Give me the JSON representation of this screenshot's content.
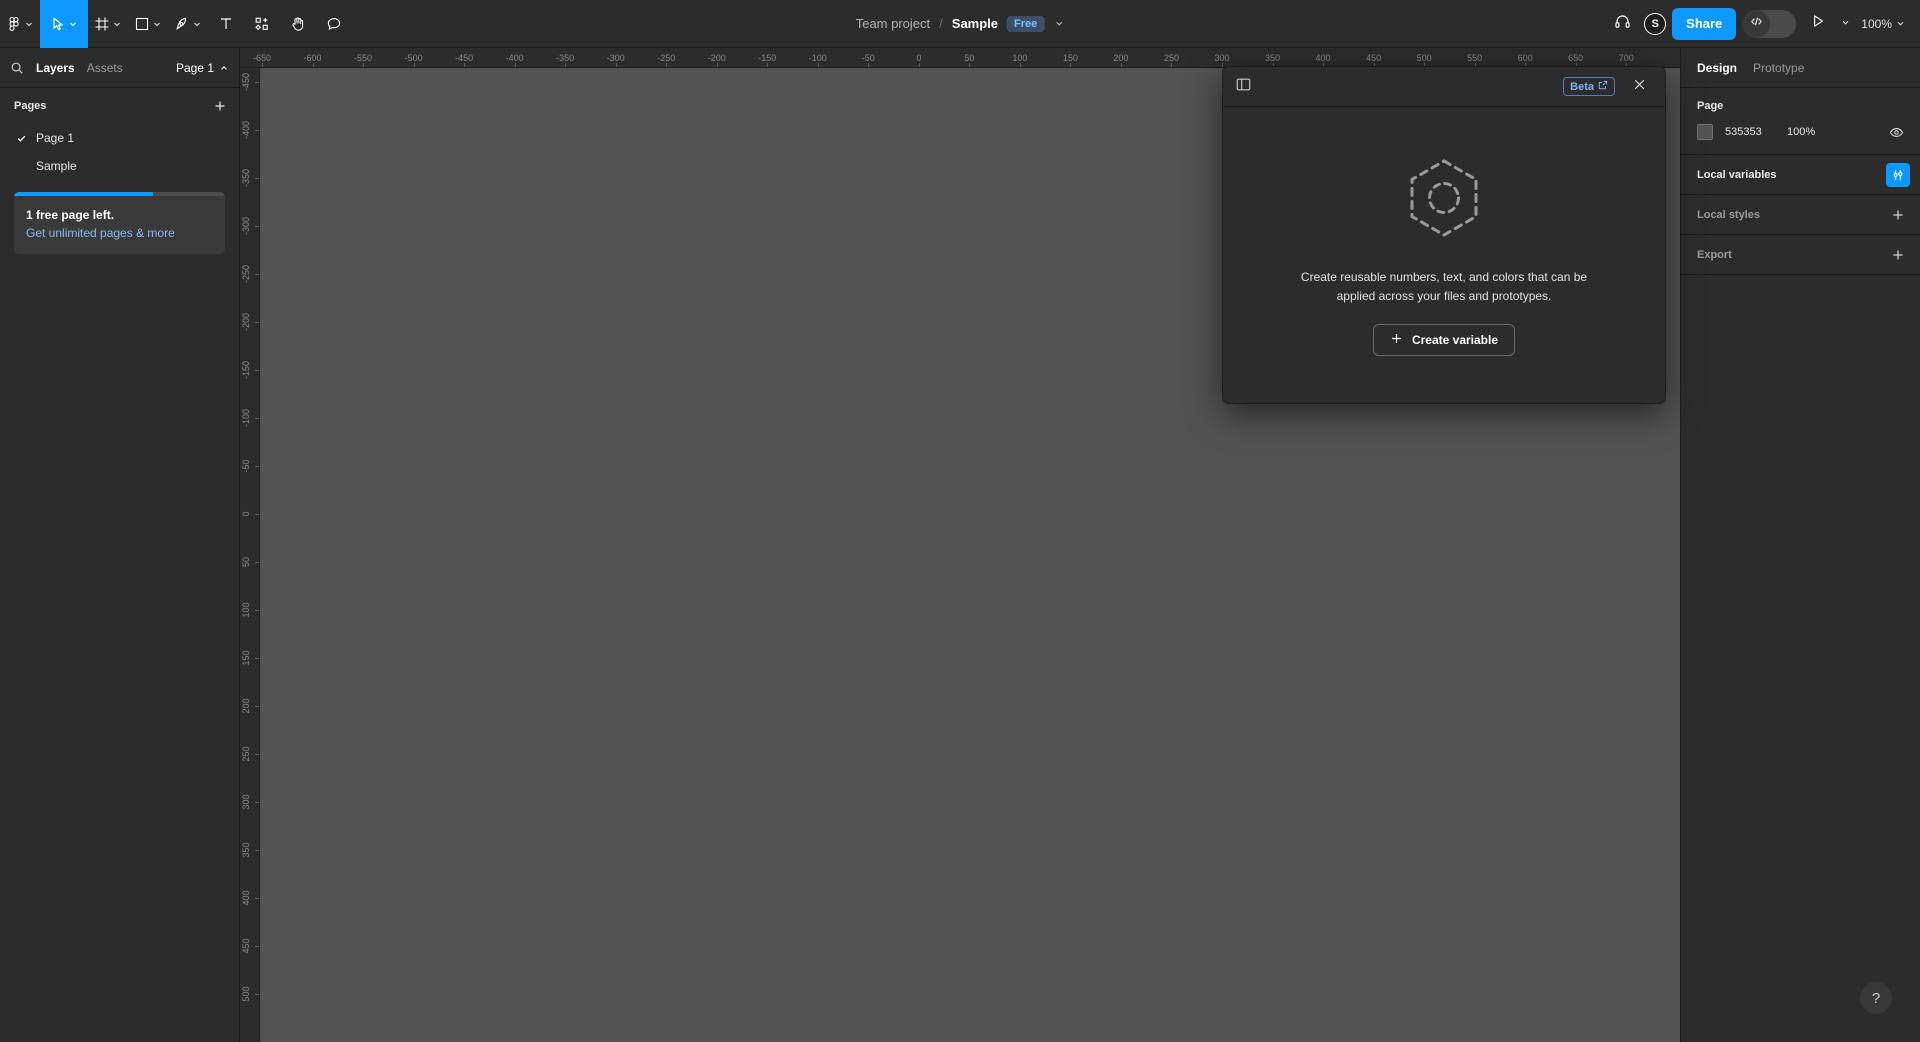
{
  "toolbar": {
    "tools": [
      {
        "name": "figma-logo",
        "icon": "figma-logo-icon",
        "has_chevron": true,
        "active": false
      },
      {
        "name": "move-tool",
        "icon": "cursor-arrow-icon",
        "has_chevron": true,
        "active": true
      },
      {
        "name": "frame-tool",
        "icon": "frame-icon",
        "has_chevron": true,
        "active": false
      },
      {
        "name": "shape-tool",
        "icon": "square-icon",
        "has_chevron": true,
        "active": false
      },
      {
        "name": "pen-tool",
        "icon": "pen-icon",
        "has_chevron": true,
        "active": false
      },
      {
        "name": "text-tool",
        "icon": "text-t-icon",
        "has_chevron": false,
        "active": false
      },
      {
        "name": "resources-tool",
        "icon": "resources-plugin-icon",
        "has_chevron": false,
        "active": false
      },
      {
        "name": "hand-tool",
        "icon": "hand-icon",
        "has_chevron": false,
        "active": false
      },
      {
        "name": "comment-tool",
        "icon": "comment-bubble-icon",
        "has_chevron": false,
        "active": false
      }
    ],
    "breadcrumb": {
      "project": "Team project",
      "separator": "/",
      "file": "Sample",
      "plan_badge": "Free"
    },
    "right": {
      "headphones_icon": "headphones-icon",
      "avatar_initial": "S",
      "share_label": "Share",
      "dev_mode_icon": "code-brackets-icon",
      "present_icon": "play-triangle-icon",
      "zoom_level": "100%"
    }
  },
  "sidebar": {
    "search_icon": "search-icon",
    "tabs": [
      {
        "label": "Layers",
        "active": true
      },
      {
        "label": "Assets",
        "active": false
      }
    ],
    "page_selector": "Page 1",
    "pages_section": {
      "title": "Pages",
      "add_icon": "plus-icon",
      "items": [
        {
          "label": "Page 1",
          "checked": true
        },
        {
          "label": "Sample",
          "checked": false
        }
      ]
    },
    "promo": {
      "progress_percent": 66,
      "title": "1 free page left.",
      "link": "Get unlimited pages & more"
    }
  },
  "rulers": {
    "horizontal": [
      "-650",
      "-600",
      "-550",
      "-500",
      "-450",
      "-400",
      "-350",
      "-300",
      "-250",
      "-200",
      "-150",
      "-100",
      "-50",
      "0",
      "50",
      "100",
      "150",
      "200",
      "250",
      "300",
      "350",
      "400",
      "450",
      "500",
      "550",
      "600",
      "650",
      "700"
    ],
    "vertical": [
      "-450",
      "-400",
      "-350",
      "-300",
      "-250",
      "-200",
      "-150",
      "-100",
      "-50",
      "0",
      "50",
      "100",
      "150",
      "200",
      "250",
      "300",
      "350",
      "400",
      "450",
      "500"
    ]
  },
  "canvas": {
    "background_color": "#535353",
    "help_label": "?"
  },
  "right_panel": {
    "tabs": [
      {
        "label": "Design",
        "active": true
      },
      {
        "label": "Prototype",
        "active": false
      }
    ],
    "page_section": {
      "title": "Page",
      "color_hex": "535353",
      "color_swatch": "#535353",
      "opacity": "100%",
      "visibility_icon": "eye-icon"
    },
    "rows": [
      {
        "label": "Local variables",
        "action_icon": "variables-sliders-icon",
        "active": true
      },
      {
        "label": "Local styles",
        "action_icon": "plus-icon",
        "active": false
      },
      {
        "label": "Export",
        "action_icon": "plus-icon",
        "active": false
      }
    ]
  },
  "variables_modal": {
    "panel_toggle_icon": "panel-layout-icon",
    "beta_label": "Beta",
    "beta_external_icon": "external-link-icon",
    "close_icon": "close-x-icon",
    "empty_art_icon": "dashed-hexagon-icon",
    "empty_text": "Create reusable numbers, text, and colors that can be applied across your files and prototypes.",
    "create_button": "Create variable",
    "create_button_icon": "plus-icon"
  },
  "colors": {
    "accent": "#0d99ff",
    "chrome": "#2c2c2c",
    "canvas": "#535353",
    "badge_free_bg": "#3d4f66"
  }
}
